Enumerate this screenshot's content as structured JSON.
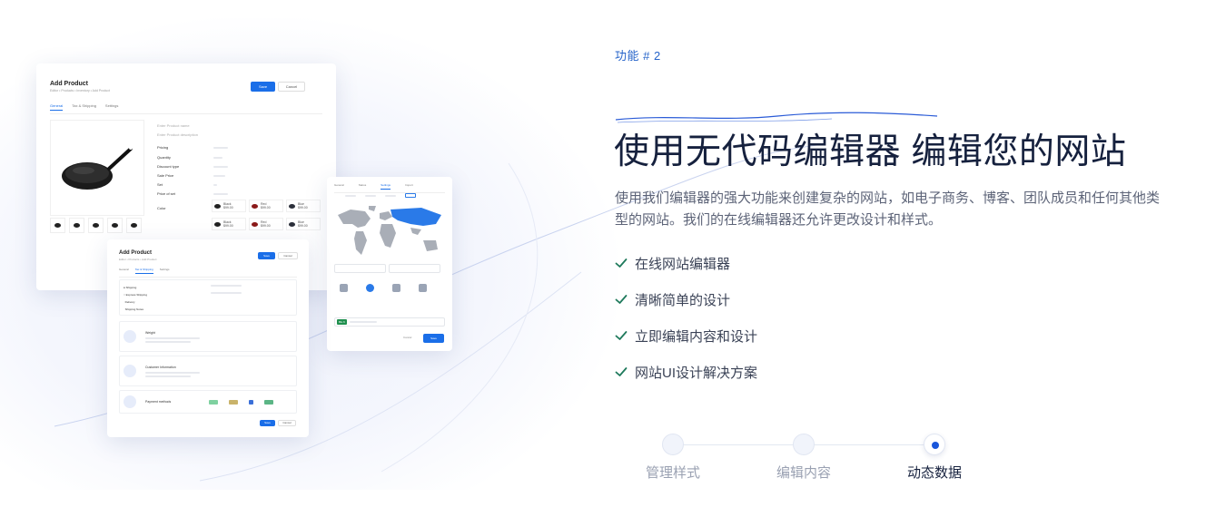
{
  "feature": {
    "tag": "功能 # 2",
    "headline": "使用无代码编辑器 编辑您的网站",
    "description": "使用我们编辑器的强大功能来创建复杂的网站，如电子商务、博客、团队成员和任何其他类型的网站。我们的在线编辑器还允许更改设计和样式。",
    "checklist": [
      "在线网站编辑器",
      "清晰简单的设计",
      "立即编辑内容和设计",
      "网站UI设计解决方案"
    ]
  },
  "steps": [
    {
      "label": "管理样式",
      "active": false
    },
    {
      "label": "编辑内容",
      "active": false
    },
    {
      "label": "动态数据",
      "active": true
    }
  ],
  "mockup_main": {
    "title": "Add Product",
    "breadcrumb": "Editor • Products • Inventory • Add Product",
    "save_label": "Save",
    "cancel_label": "Cancel",
    "tabs": [
      "General",
      "Tax & Shipping",
      "Settings"
    ],
    "name_placeholder": "Enter Product name",
    "desc_placeholder": "Enter Product description",
    "fields": [
      "Pricing",
      "Quantity",
      "Discount type",
      "Sale Price",
      "Set",
      "Price of set"
    ],
    "color_label": "Color",
    "swatches": [
      {
        "name": "Black",
        "price": "$99.00",
        "color": "#222222"
      },
      {
        "name": "Red",
        "price": "$99.00",
        "color": "#8b1a1a"
      },
      {
        "name": "Blue",
        "price": "$99.00",
        "color": "#2b2f3a"
      },
      {
        "name": "Black",
        "price": "$99.00",
        "color": "#222222"
      },
      {
        "name": "Red",
        "price": "$99.00",
        "color": "#8b1a1a"
      },
      {
        "name": "Blue",
        "price": "$99.00",
        "color": "#2b2f3a"
      }
    ]
  },
  "mockup_secondary": {
    "title": "Add Product",
    "breadcrumb": "Editor • Products • Add Product",
    "save_label": "Save",
    "cancel_label": "Cancel",
    "tabs": [
      "General",
      "Tax & Shipping",
      "Settings"
    ],
    "shipping_options": [
      "Shipping",
      "Express Shipping",
      "Delivery",
      "Shipping Notes"
    ],
    "sections": [
      {
        "title": "Weight"
      },
      {
        "title": "Customer Information"
      },
      {
        "title": "Payment methods"
      }
    ],
    "primary_label": "Save",
    "secondary_label": "Cancel"
  },
  "mockup_map": {
    "tabs": [
      "General",
      "Status",
      "Settings",
      "Import"
    ],
    "tag": "Blu 6",
    "cancel_label": "Cancel",
    "save_label": "Save"
  }
}
